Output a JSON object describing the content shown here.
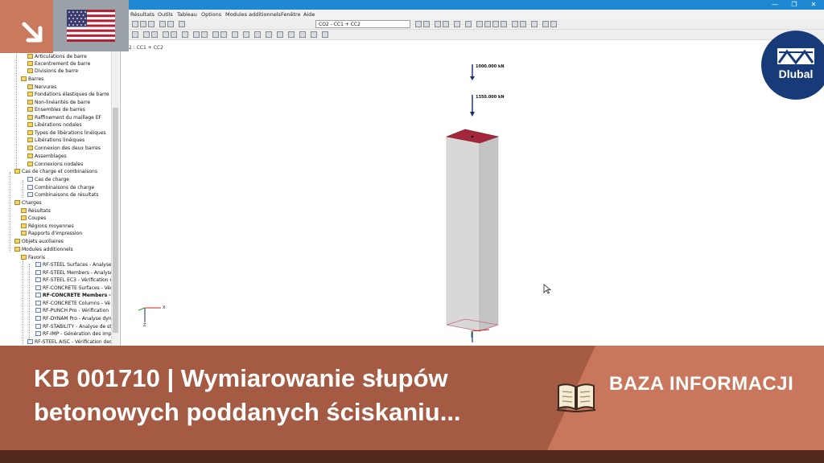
{
  "window": {
    "min_glyph": "—",
    "max_glyph": "❐",
    "close_glyph": "✕"
  },
  "menu": {
    "items": [
      "Résultats",
      "Outils",
      "Tableau",
      "Options",
      "Modules additionnels",
      "Fenêtre",
      "Aide"
    ]
  },
  "toolbar": {
    "load_combo_value": "CO2 - CC1 + CC2"
  },
  "navigator": {
    "items": [
      {
        "label": "Articulations de barre",
        "icon": "folder-icon"
      },
      {
        "label": "Excentrement de barre",
        "icon": "folder-icon"
      },
      {
        "label": "Divisions de barre",
        "icon": "folder-icon"
      },
      {
        "label": "Barres",
        "icon": "folder-icon"
      },
      {
        "label": "Nervures",
        "icon": "folder-icon"
      },
      {
        "label": "Fondations élastiques de barre",
        "icon": "folder-icon"
      },
      {
        "label": "Non-linéarités de barre",
        "icon": "folder-icon"
      },
      {
        "label": "Ensembles de barres",
        "icon": "folder-icon"
      },
      {
        "label": "Raffinement du maillage EF",
        "icon": "folder-icon"
      },
      {
        "label": "Libérations nodales",
        "icon": "folder-icon"
      },
      {
        "label": "Types de libérations linéiques",
        "icon": "folder-icon"
      },
      {
        "label": "Libérations linéiques",
        "icon": "folder-icon"
      },
      {
        "label": "Connexion des deux barres",
        "icon": "folder-icon"
      },
      {
        "label": "Assemblages",
        "icon": "folder-icon"
      },
      {
        "label": "Connexions nodales",
        "icon": "folder-icon"
      },
      {
        "label": "Cas de charge et combinaisons",
        "icon": "folder-icon"
      },
      {
        "label": "Cas de charge",
        "icon": "doc-icon"
      },
      {
        "label": "Combinaisons de charge",
        "icon": "doc-icon"
      },
      {
        "label": "Combinaisons de résultats",
        "icon": "doc-icon"
      },
      {
        "label": "Charges",
        "icon": "folder-icon"
      },
      {
        "label": "Résultats",
        "icon": "folder-icon"
      },
      {
        "label": "Coupes",
        "icon": "folder-icon"
      },
      {
        "label": "Régions moyennes",
        "icon": "folder-icon"
      },
      {
        "label": "Rapports d'impression",
        "icon": "folder-icon"
      },
      {
        "label": "Objets auxiliaires",
        "icon": "folder-icon"
      },
      {
        "label": "Modules additionnels",
        "icon": "folder-icon"
      },
      {
        "label": "Favoris",
        "icon": "folder-icon"
      },
      {
        "label": "RF-STEEL Surfaces - Analyse c",
        "icon": "doc-icon"
      },
      {
        "label": "RF-STEEL Members - Analyse",
        "icon": "doc-icon"
      },
      {
        "label": "RF-STEEL EC3 - Vérification d",
        "icon": "doc-icon"
      },
      {
        "label": "RF-CONCRETE Surfaces - Vér",
        "icon": "doc-icon"
      },
      {
        "label": "RF-CONCRETE Members - C",
        "icon": "doc-icon"
      },
      {
        "label": "RF-CONCRETE Columns - Vé",
        "icon": "doc-icon"
      },
      {
        "label": "RF-PUNCH Pro - Vérification",
        "icon": "doc-icon"
      },
      {
        "label": "RF-DYNAM Pro - Analyse dyn",
        "icon": "doc-icon"
      },
      {
        "label": "RF-STABILITY - Analyse de sta",
        "icon": "doc-icon"
      },
      {
        "label": "RF-IMP - Génération des imp",
        "icon": "doc-icon"
      },
      {
        "label": "RF-STEEL AISC - Vérification des",
        "icon": "doc-icon"
      }
    ]
  },
  "viewport": {
    "label": "2 : CC1 + CC2",
    "loads": [
      "1000.000 kN",
      "1350.000 kN"
    ],
    "axes": {
      "x": "X",
      "z": "Z"
    }
  },
  "brand": {
    "name": "Dlubal"
  },
  "banner": {
    "title": "KB 001710 | Wymiarowanie słupów betonowych poddanych ściskaniu...",
    "label": "BAZA INFORMACJI"
  },
  "colors": {
    "accent": "#c97a5c",
    "banner": "#a55a43",
    "banner_dark": "#51291c",
    "column_top": "#a3263c",
    "load_arrow": "#1a2a6c",
    "dlubal_blue": "#173a78"
  }
}
